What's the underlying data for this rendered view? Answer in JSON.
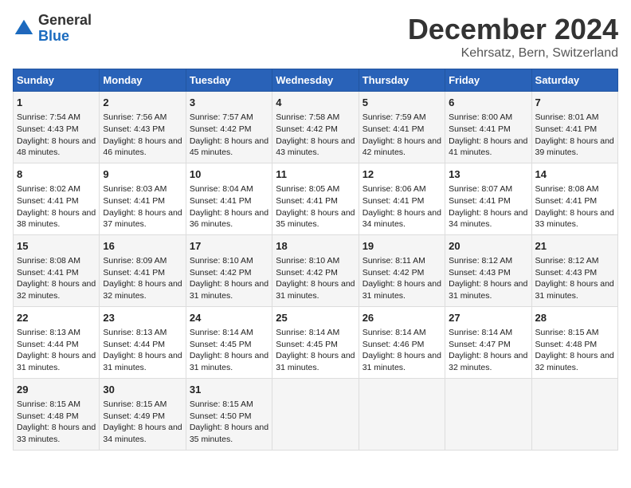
{
  "logo": {
    "general": "General",
    "blue": "Blue"
  },
  "title": "December 2024",
  "subtitle": "Kehrsatz, Bern, Switzerland",
  "days_header": [
    "Sunday",
    "Monday",
    "Tuesday",
    "Wednesday",
    "Thursday",
    "Friday",
    "Saturday"
  ],
  "weeks": [
    [
      {
        "num": "1",
        "sunrise": "Sunrise: 7:54 AM",
        "sunset": "Sunset: 4:43 PM",
        "daylight": "Daylight: 8 hours and 48 minutes."
      },
      {
        "num": "2",
        "sunrise": "Sunrise: 7:56 AM",
        "sunset": "Sunset: 4:43 PM",
        "daylight": "Daylight: 8 hours and 46 minutes."
      },
      {
        "num": "3",
        "sunrise": "Sunrise: 7:57 AM",
        "sunset": "Sunset: 4:42 PM",
        "daylight": "Daylight: 8 hours and 45 minutes."
      },
      {
        "num": "4",
        "sunrise": "Sunrise: 7:58 AM",
        "sunset": "Sunset: 4:42 PM",
        "daylight": "Daylight: 8 hours and 43 minutes."
      },
      {
        "num": "5",
        "sunrise": "Sunrise: 7:59 AM",
        "sunset": "Sunset: 4:41 PM",
        "daylight": "Daylight: 8 hours and 42 minutes."
      },
      {
        "num": "6",
        "sunrise": "Sunrise: 8:00 AM",
        "sunset": "Sunset: 4:41 PM",
        "daylight": "Daylight: 8 hours and 41 minutes."
      },
      {
        "num": "7",
        "sunrise": "Sunrise: 8:01 AM",
        "sunset": "Sunset: 4:41 PM",
        "daylight": "Daylight: 8 hours and 39 minutes."
      }
    ],
    [
      {
        "num": "8",
        "sunrise": "Sunrise: 8:02 AM",
        "sunset": "Sunset: 4:41 PM",
        "daylight": "Daylight: 8 hours and 38 minutes."
      },
      {
        "num": "9",
        "sunrise": "Sunrise: 8:03 AM",
        "sunset": "Sunset: 4:41 PM",
        "daylight": "Daylight: 8 hours and 37 minutes."
      },
      {
        "num": "10",
        "sunrise": "Sunrise: 8:04 AM",
        "sunset": "Sunset: 4:41 PM",
        "daylight": "Daylight: 8 hours and 36 minutes."
      },
      {
        "num": "11",
        "sunrise": "Sunrise: 8:05 AM",
        "sunset": "Sunset: 4:41 PM",
        "daylight": "Daylight: 8 hours and 35 minutes."
      },
      {
        "num": "12",
        "sunrise": "Sunrise: 8:06 AM",
        "sunset": "Sunset: 4:41 PM",
        "daylight": "Daylight: 8 hours and 34 minutes."
      },
      {
        "num": "13",
        "sunrise": "Sunrise: 8:07 AM",
        "sunset": "Sunset: 4:41 PM",
        "daylight": "Daylight: 8 hours and 34 minutes."
      },
      {
        "num": "14",
        "sunrise": "Sunrise: 8:08 AM",
        "sunset": "Sunset: 4:41 PM",
        "daylight": "Daylight: 8 hours and 33 minutes."
      }
    ],
    [
      {
        "num": "15",
        "sunrise": "Sunrise: 8:08 AM",
        "sunset": "Sunset: 4:41 PM",
        "daylight": "Daylight: 8 hours and 32 minutes."
      },
      {
        "num": "16",
        "sunrise": "Sunrise: 8:09 AM",
        "sunset": "Sunset: 4:41 PM",
        "daylight": "Daylight: 8 hours and 32 minutes."
      },
      {
        "num": "17",
        "sunrise": "Sunrise: 8:10 AM",
        "sunset": "Sunset: 4:42 PM",
        "daylight": "Daylight: 8 hours and 31 minutes."
      },
      {
        "num": "18",
        "sunrise": "Sunrise: 8:10 AM",
        "sunset": "Sunset: 4:42 PM",
        "daylight": "Daylight: 8 hours and 31 minutes."
      },
      {
        "num": "19",
        "sunrise": "Sunrise: 8:11 AM",
        "sunset": "Sunset: 4:42 PM",
        "daylight": "Daylight: 8 hours and 31 minutes."
      },
      {
        "num": "20",
        "sunrise": "Sunrise: 8:12 AM",
        "sunset": "Sunset: 4:43 PM",
        "daylight": "Daylight: 8 hours and 31 minutes."
      },
      {
        "num": "21",
        "sunrise": "Sunrise: 8:12 AM",
        "sunset": "Sunset: 4:43 PM",
        "daylight": "Daylight: 8 hours and 31 minutes."
      }
    ],
    [
      {
        "num": "22",
        "sunrise": "Sunrise: 8:13 AM",
        "sunset": "Sunset: 4:44 PM",
        "daylight": "Daylight: 8 hours and 31 minutes."
      },
      {
        "num": "23",
        "sunrise": "Sunrise: 8:13 AM",
        "sunset": "Sunset: 4:44 PM",
        "daylight": "Daylight: 8 hours and 31 minutes."
      },
      {
        "num": "24",
        "sunrise": "Sunrise: 8:14 AM",
        "sunset": "Sunset: 4:45 PM",
        "daylight": "Daylight: 8 hours and 31 minutes."
      },
      {
        "num": "25",
        "sunrise": "Sunrise: 8:14 AM",
        "sunset": "Sunset: 4:45 PM",
        "daylight": "Daylight: 8 hours and 31 minutes."
      },
      {
        "num": "26",
        "sunrise": "Sunrise: 8:14 AM",
        "sunset": "Sunset: 4:46 PM",
        "daylight": "Daylight: 8 hours and 31 minutes."
      },
      {
        "num": "27",
        "sunrise": "Sunrise: 8:14 AM",
        "sunset": "Sunset: 4:47 PM",
        "daylight": "Daylight: 8 hours and 32 minutes."
      },
      {
        "num": "28",
        "sunrise": "Sunrise: 8:15 AM",
        "sunset": "Sunset: 4:48 PM",
        "daylight": "Daylight: 8 hours and 32 minutes."
      }
    ],
    [
      {
        "num": "29",
        "sunrise": "Sunrise: 8:15 AM",
        "sunset": "Sunset: 4:48 PM",
        "daylight": "Daylight: 8 hours and 33 minutes."
      },
      {
        "num": "30",
        "sunrise": "Sunrise: 8:15 AM",
        "sunset": "Sunset: 4:49 PM",
        "daylight": "Daylight: 8 hours and 34 minutes."
      },
      {
        "num": "31",
        "sunrise": "Sunrise: 8:15 AM",
        "sunset": "Sunset: 4:50 PM",
        "daylight": "Daylight: 8 hours and 35 minutes."
      },
      null,
      null,
      null,
      null
    ]
  ]
}
